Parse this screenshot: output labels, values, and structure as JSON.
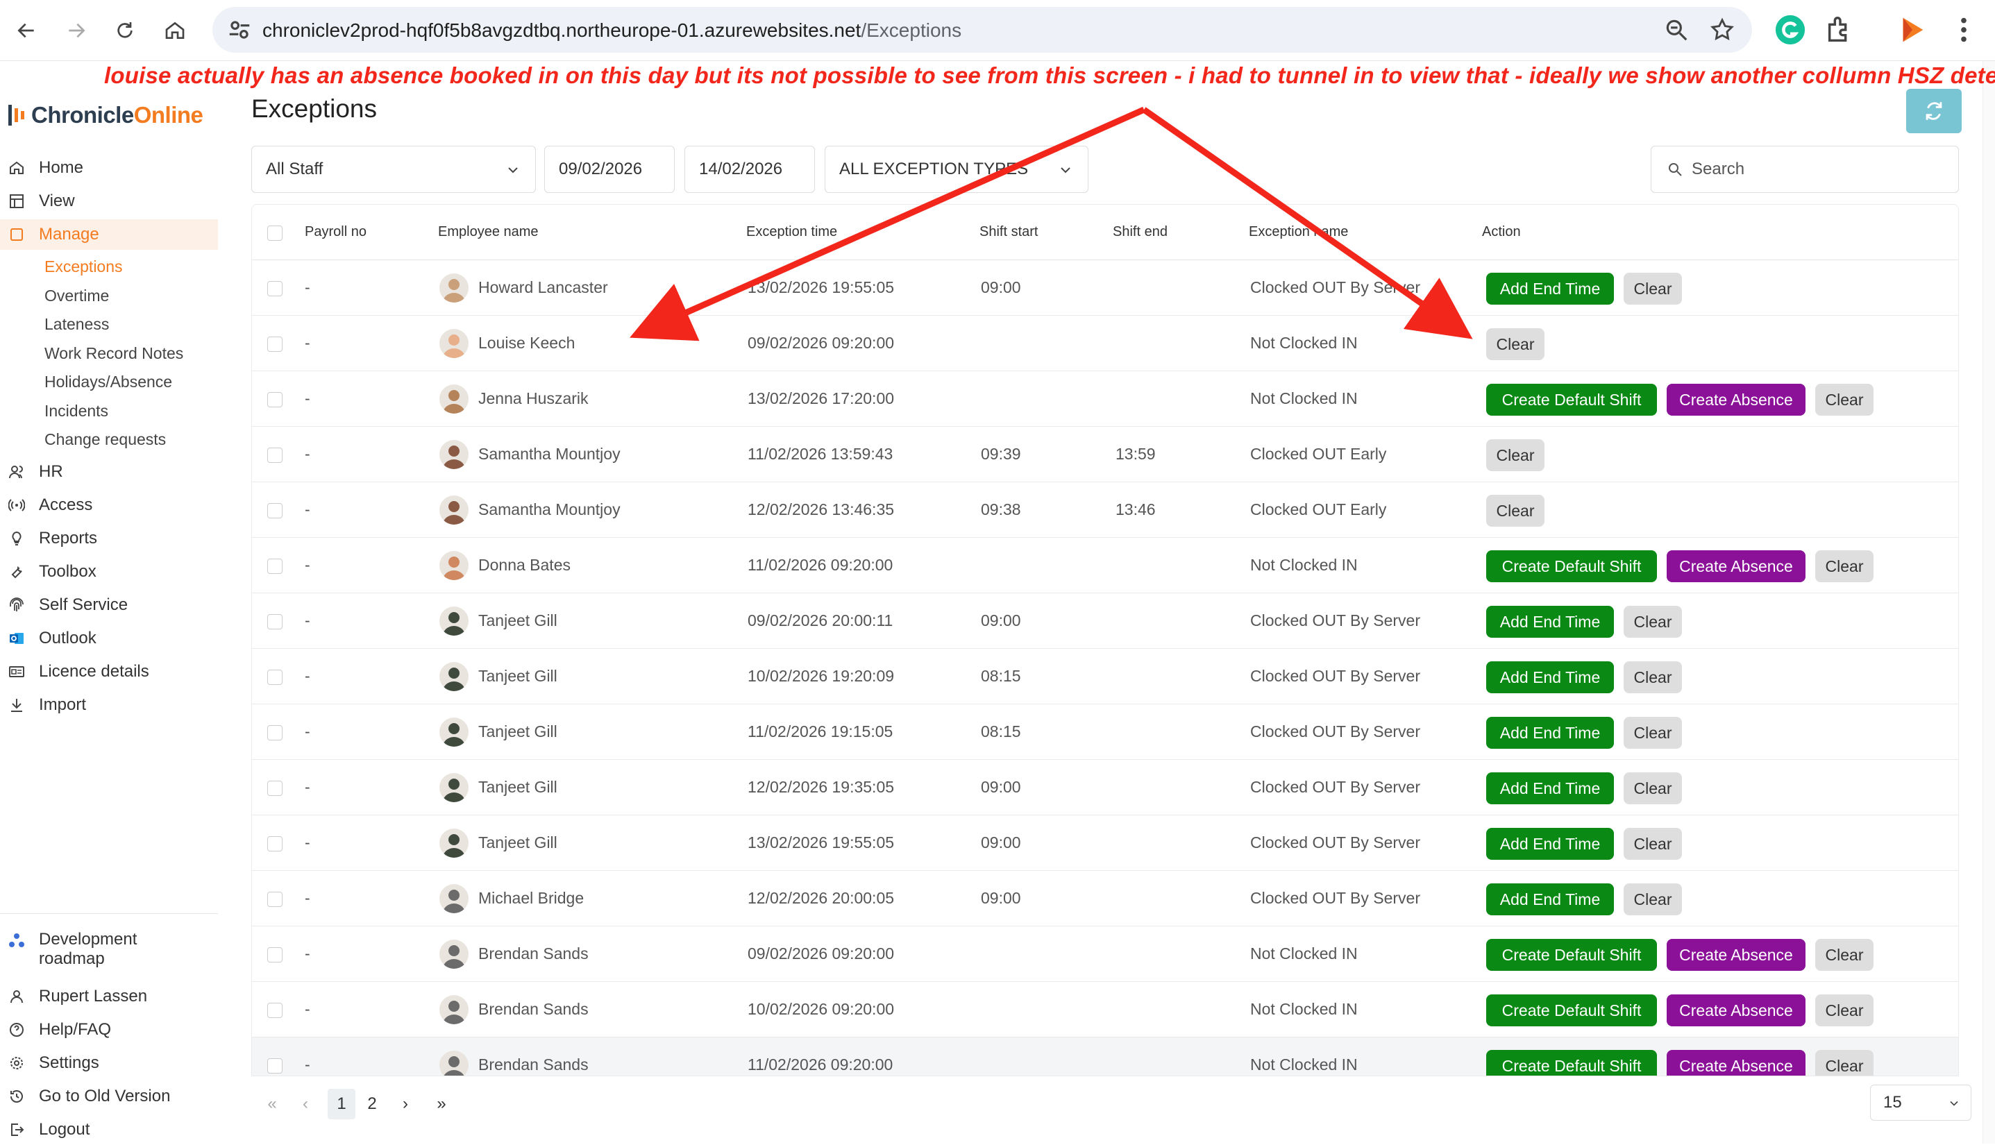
{
  "browser": {
    "url_domain": "chroniclev2prod-hqf0f5b8avgzdtbq.northeurope-01.azurewebsites.net",
    "url_path": "/Exceptions"
  },
  "annotation": "louise actually has an absence booked in on this day but its not possible to see from this screen - i had to tunnel in to view that - ideally we show another collumn HSZ detected",
  "app": {
    "logo_primary": "Chronicle",
    "logo_accent": "Online"
  },
  "sidebar": {
    "items": [
      {
        "label": "Home",
        "icon": "home-icon"
      },
      {
        "label": "View",
        "icon": "grid-icon"
      },
      {
        "label": "Manage",
        "icon": "square-icon"
      }
    ],
    "manage_sub": [
      "Exceptions",
      "Overtime",
      "Lateness",
      "Work Record Notes",
      "Holidays/Absence",
      "Incidents",
      "Change requests"
    ],
    "items2": [
      {
        "label": "HR",
        "icon": "people-icon"
      },
      {
        "label": "Access",
        "icon": "signal-icon"
      },
      {
        "label": "Reports",
        "icon": "bulb-icon"
      },
      {
        "label": "Toolbox",
        "icon": "wrench-icon"
      },
      {
        "label": "Self Service",
        "icon": "fingerprint-icon"
      },
      {
        "label": "Outlook",
        "icon": "outlook-icon"
      },
      {
        "label": "Licence details",
        "icon": "card-icon"
      },
      {
        "label": "Import",
        "icon": "download-icon"
      }
    ],
    "bottom": [
      {
        "label": "Development roadmap",
        "icon": "roadmap-icon"
      },
      {
        "label": "Rupert Lassen",
        "icon": "user-icon"
      },
      {
        "label": "Help/FAQ",
        "icon": "help-icon"
      },
      {
        "label": "Settings",
        "icon": "gear-icon"
      },
      {
        "label": "Go to Old Version",
        "icon": "history-icon"
      },
      {
        "label": "Logout",
        "icon": "logout-icon"
      }
    ]
  },
  "page": {
    "title": "Exceptions"
  },
  "filters": {
    "staff": "All Staff",
    "date_from": "09/02/2026",
    "date_to": "14/02/2026",
    "exception_type": "ALL EXCEPTION TYPES",
    "search_placeholder": "Search"
  },
  "table": {
    "columns": [
      "Payroll no",
      "Employee name",
      "Exception time",
      "Shift start",
      "Shift end",
      "Exception name",
      "Action"
    ],
    "rows": [
      {
        "payroll": "-",
        "name": "Howard Lancaster",
        "time": "13/02/2026 19:55:05",
        "start": "09:00",
        "end": "",
        "exception": "Clocked OUT By Server",
        "actions": [
          "Add End Time",
          "Clear"
        ]
      },
      {
        "payroll": "-",
        "name": "Louise Keech",
        "time": "09/02/2026 09:20:00",
        "start": "",
        "end": "",
        "exception": "Not Clocked IN",
        "actions": [
          "Clear"
        ]
      },
      {
        "payroll": "-",
        "name": "Jenna Huszarik",
        "time": "13/02/2026 17:20:00",
        "start": "",
        "end": "",
        "exception": "Not Clocked IN",
        "actions": [
          "Create Default Shift",
          "Create Absence",
          "Clear"
        ]
      },
      {
        "payroll": "-",
        "name": "Samantha Mountjoy",
        "time": "11/02/2026 13:59:43",
        "start": "09:39",
        "end": "13:59",
        "exception": "Clocked OUT Early",
        "actions": [
          "Clear"
        ]
      },
      {
        "payroll": "-",
        "name": "Samantha Mountjoy",
        "time": "12/02/2026 13:46:35",
        "start": "09:38",
        "end": "13:46",
        "exception": "Clocked OUT Early",
        "actions": [
          "Clear"
        ]
      },
      {
        "payroll": "-",
        "name": "Donna Bates",
        "time": "11/02/2026 09:20:00",
        "start": "",
        "end": "",
        "exception": "Not Clocked IN",
        "actions": [
          "Create Default Shift",
          "Create Absence",
          "Clear"
        ]
      },
      {
        "payroll": "-",
        "name": "Tanjeet Gill",
        "time": "09/02/2026 20:00:11",
        "start": "09:00",
        "end": "",
        "exception": "Clocked OUT By Server",
        "actions": [
          "Add End Time",
          "Clear"
        ]
      },
      {
        "payroll": "-",
        "name": "Tanjeet Gill",
        "time": "10/02/2026 19:20:09",
        "start": "08:15",
        "end": "",
        "exception": "Clocked OUT By Server",
        "actions": [
          "Add End Time",
          "Clear"
        ]
      },
      {
        "payroll": "-",
        "name": "Tanjeet Gill",
        "time": "11/02/2026 19:15:05",
        "start": "08:15",
        "end": "",
        "exception": "Clocked OUT By Server",
        "actions": [
          "Add End Time",
          "Clear"
        ]
      },
      {
        "payroll": "-",
        "name": "Tanjeet Gill",
        "time": "12/02/2026 19:35:05",
        "start": "09:00",
        "end": "",
        "exception": "Clocked OUT By Server",
        "actions": [
          "Add End Time",
          "Clear"
        ]
      },
      {
        "payroll": "-",
        "name": "Tanjeet Gill",
        "time": "13/02/2026 19:55:05",
        "start": "09:00",
        "end": "",
        "exception": "Clocked OUT By Server",
        "actions": [
          "Add End Time",
          "Clear"
        ]
      },
      {
        "payroll": "-",
        "name": "Michael Bridge",
        "time": "12/02/2026 20:00:05",
        "start": "09:00",
        "end": "",
        "exception": "Clocked OUT By Server",
        "actions": [
          "Add End Time",
          "Clear"
        ]
      },
      {
        "payroll": "-",
        "name": "Brendan Sands",
        "time": "09/02/2026 09:20:00",
        "start": "",
        "end": "",
        "exception": "Not Clocked IN",
        "actions": [
          "Create Default Shift",
          "Create Absence",
          "Clear"
        ]
      },
      {
        "payroll": "-",
        "name": "Brendan Sands",
        "time": "10/02/2026 09:20:00",
        "start": "",
        "end": "",
        "exception": "Not Clocked IN",
        "actions": [
          "Create Default Shift",
          "Create Absence",
          "Clear"
        ]
      },
      {
        "payroll": "-",
        "name": "Brendan Sands",
        "time": "11/02/2026 09:20:00",
        "start": "",
        "end": "",
        "exception": "Not Clocked IN",
        "actions": [
          "Create Default Shift",
          "Create Absence",
          "Clear"
        ]
      }
    ]
  },
  "pagination": {
    "first": "«",
    "prev": "‹",
    "pages": [
      "1",
      "2"
    ],
    "next": "›",
    "last": "»",
    "per_page": "15"
  },
  "colors": {
    "brand_orange": "#f47c20",
    "green_button": "#0a8a14",
    "purple_button": "#8b1198",
    "annotation_red": "#f2261b",
    "refresh_teal": "#79c5d4"
  }
}
